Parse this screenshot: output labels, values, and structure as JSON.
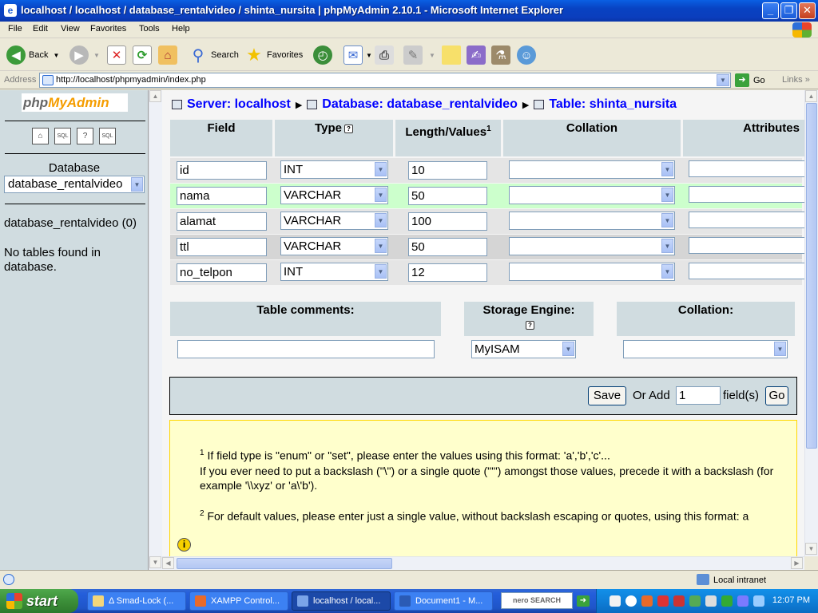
{
  "window": {
    "title": "localhost / localhost / database_rentalvideo / shinta_nursita | phpMyAdmin 2.10.1 - Microsoft Internet Explorer",
    "min": "_",
    "max": "❐",
    "close": "✕"
  },
  "menu": [
    "File",
    "Edit",
    "View",
    "Favorites",
    "Tools",
    "Help"
  ],
  "toolbar": {
    "back": "Back",
    "search": "Search",
    "favorites": "Favorites"
  },
  "address": {
    "label": "Address",
    "url": "http://localhost/phpmyadmin/index.php",
    "go": "Go",
    "links": "Links"
  },
  "left": {
    "logo_php": "php",
    "logo_ma": "MyAdmin",
    "icons": [
      "⌂",
      "SQL",
      "?",
      "SQL"
    ],
    "db_label": "Database",
    "db_select": "database_rentalvideo",
    "db_name": "database_rentalvideo (0)",
    "no_tables": "No tables found in database."
  },
  "breadcrumb": {
    "server": "Server: localhost",
    "database": "Database: database_rentalvideo",
    "table": "Table: shinta_nursita"
  },
  "headers": {
    "field": "Field",
    "type": "Type",
    "type_help": "?",
    "length": "Length/Values",
    "length_sup": "1",
    "collation": "Collation",
    "attributes": "Attributes"
  },
  "rows": [
    {
      "field": "id",
      "type": "INT",
      "length": "10"
    },
    {
      "field": "nama",
      "type": "VARCHAR",
      "length": "50"
    },
    {
      "field": "alamat",
      "type": "VARCHAR",
      "length": "100"
    },
    {
      "field": "ttl",
      "type": "VARCHAR",
      "length": "50"
    },
    {
      "field": "no_telpon",
      "type": "INT",
      "length": "12"
    }
  ],
  "table_opts": {
    "comments_label": "Table comments:",
    "engine_label": "Storage Engine:",
    "engine_help": "?",
    "engine_value": "MyISAM",
    "collation_label": "Collation:"
  },
  "save": {
    "save_label": "Save",
    "or_add": "Or Add",
    "add_count": "1",
    "fields_label": "field(s)",
    "go_label": "Go"
  },
  "notes": {
    "n1_sup": "1",
    "n1_text": " If field type is \"enum\" or \"set\", please enter the values using this format: 'a','b','c'...",
    "n1_more": "If you ever need to put a backslash (\"\\\") or a single quote (\"'\") amongst those values, precede it with a backslash (for example '\\\\xyz' or 'a\\'b').",
    "n2_sup": "2",
    "n2_text": " For default values, please enter just a single value, without backslash escaping or quotes, using this format: a",
    "info_icon": "i"
  },
  "status": {
    "zone": "Local intranet"
  },
  "taskbar": {
    "start": "start",
    "tasks": [
      "Δ Smad-Lock (...",
      "XAMPP Control...",
      "localhost / local...",
      "Document1 - M..."
    ],
    "nero": "nero SEARCH",
    "clock": "12:07 PM"
  },
  "colors": {
    "header_bg": "#d0dce0",
    "row_odd": "#e5e5e5",
    "row_even": "#d5d5d5",
    "row_hover": "#ccffcc",
    "link": "#0000ff",
    "note_bg": "#ffffcc"
  }
}
